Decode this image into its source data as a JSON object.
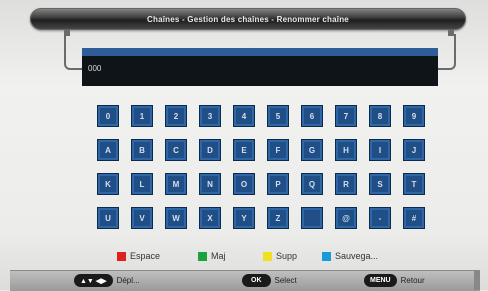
{
  "header": {
    "title": "Chaînes - Gestion des chaînes - Renommer chaîne"
  },
  "input": {
    "value": "000"
  },
  "keyboard": {
    "keys": [
      "0",
      "1",
      "2",
      "3",
      "4",
      "5",
      "6",
      "7",
      "8",
      "9",
      "A",
      "B",
      "C",
      "D",
      "E",
      "F",
      "G",
      "H",
      "I",
      "J",
      "K",
      "L",
      "M",
      "N",
      "O",
      "P",
      "Q",
      "R",
      "S",
      "T",
      "U",
      "V",
      "W",
      "X",
      "Y",
      "Z",
      "",
      "@",
      "-",
      "#"
    ]
  },
  "legend": [
    {
      "label": "Espace",
      "color": "#e02020"
    },
    {
      "label": "Maj",
      "color": "#1aa33a"
    },
    {
      "label": "Supp",
      "color": "#f0e020"
    },
    {
      "label": "Sauvega...",
      "color": "#1a9ad8"
    }
  ],
  "footer": {
    "nav_key": "▲▼ ◀▶",
    "nav_label": "Dépl...",
    "ok_key": "OK",
    "ok_label": "Select",
    "menu_key": "MENU",
    "menu_label": "Retour"
  }
}
